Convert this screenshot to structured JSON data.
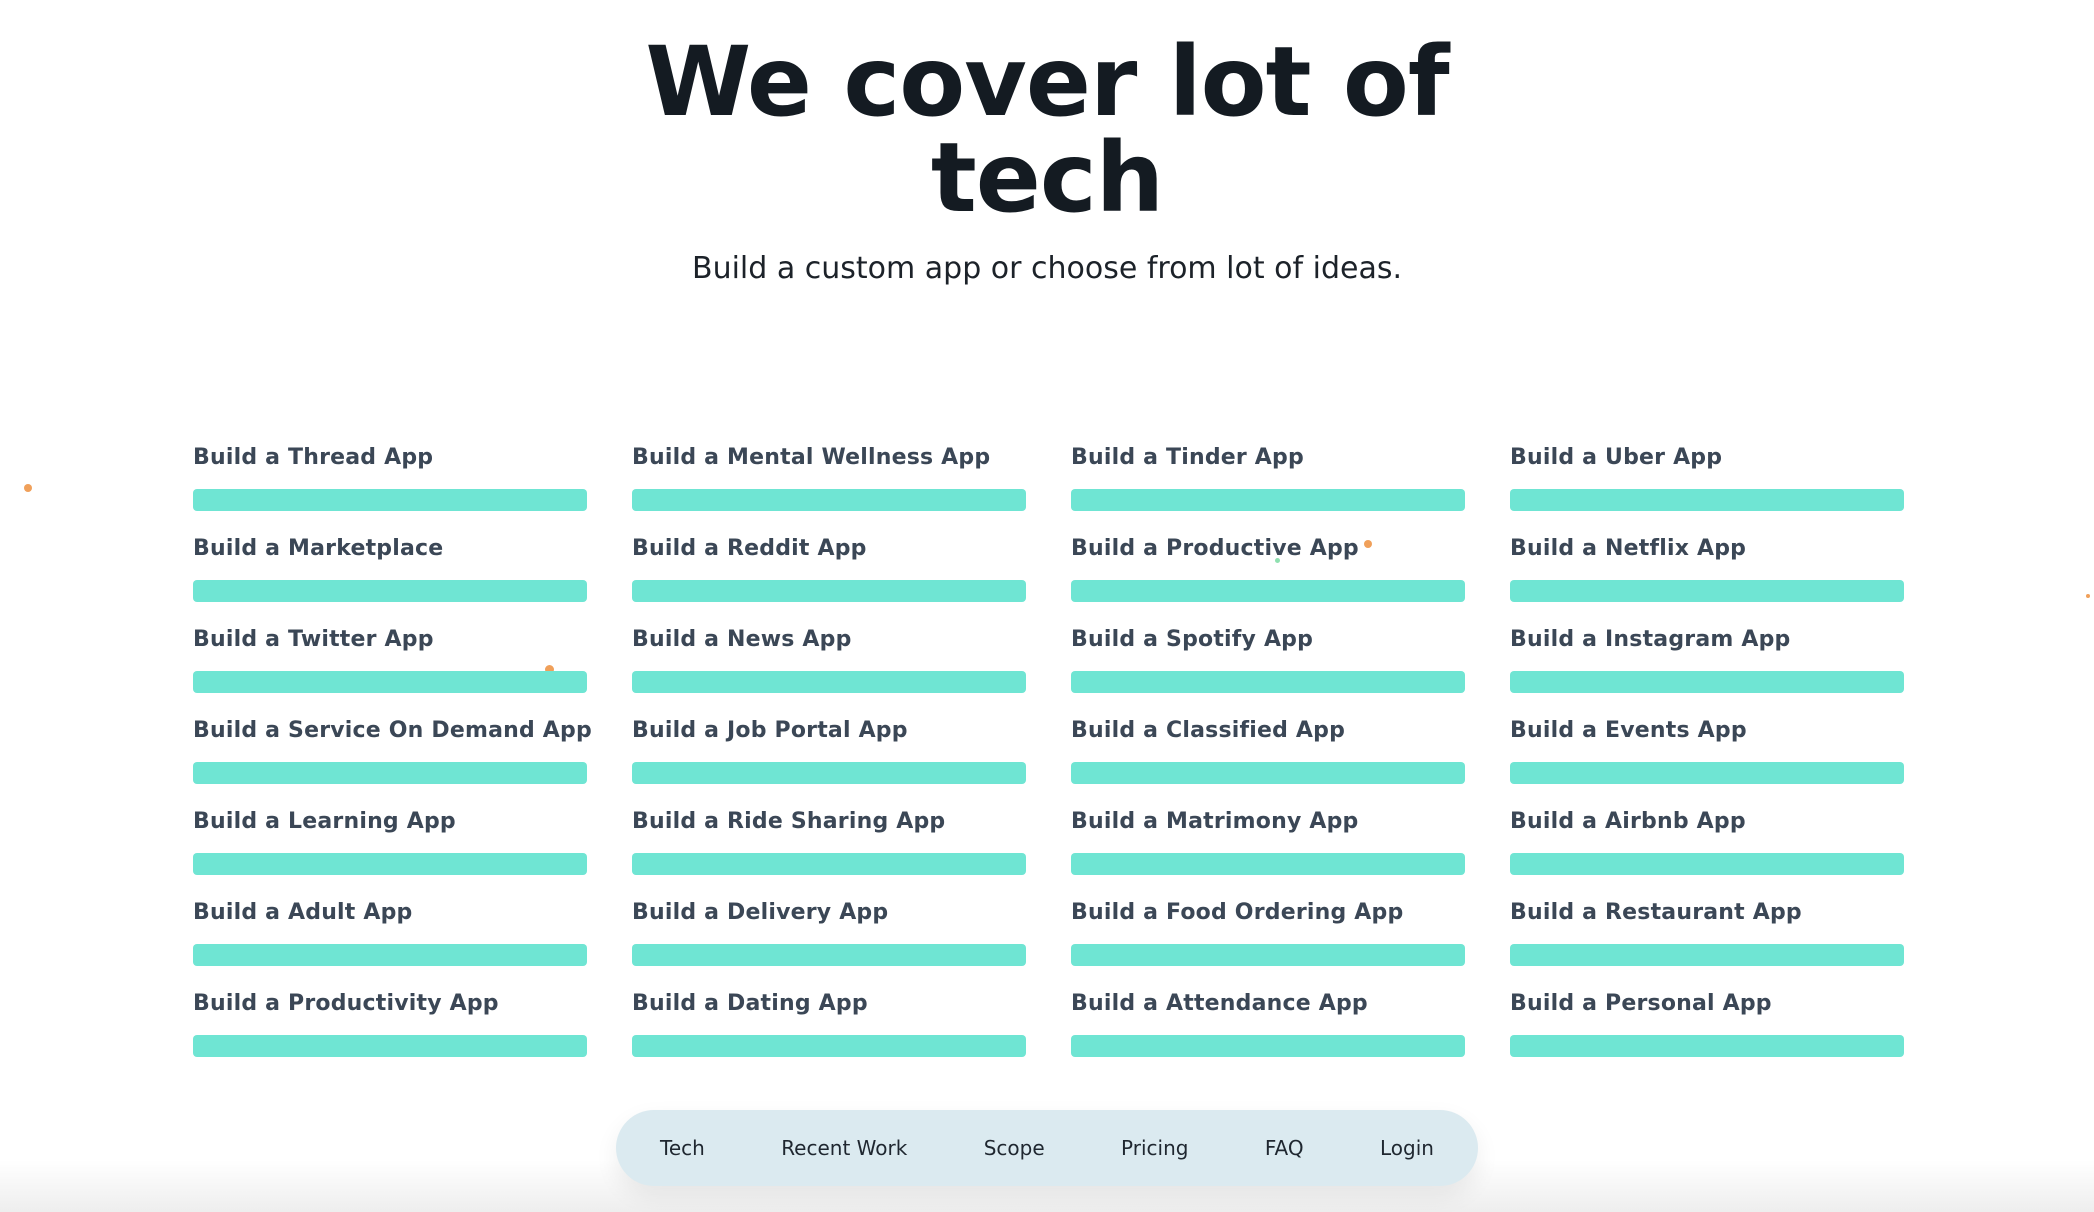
{
  "hero": {
    "title_line1": "We cover lot of",
    "title_line2": "tech",
    "subtitle": "Build a custom app or choose from lot of ideas."
  },
  "apps": [
    {
      "label": "Build a Thread App"
    },
    {
      "label": "Build a Mental Wellness App"
    },
    {
      "label": "Build a Tinder App"
    },
    {
      "label": "Build a Uber App"
    },
    {
      "label": "Build a Marketplace"
    },
    {
      "label": "Build a Reddit App"
    },
    {
      "label": "Build a Productive App"
    },
    {
      "label": "Build a Netflix App"
    },
    {
      "label": "Build a Twitter App"
    },
    {
      "label": "Build a News App"
    },
    {
      "label": "Build a Spotify App"
    },
    {
      "label": "Build a Instagram App"
    },
    {
      "label": "Build a Service On Demand App"
    },
    {
      "label": "Build a Job Portal App"
    },
    {
      "label": "Build a Classified App"
    },
    {
      "label": "Build a Events App"
    },
    {
      "label": "Build a Learning App"
    },
    {
      "label": "Build a Ride Sharing App"
    },
    {
      "label": "Build a Matrimony App"
    },
    {
      "label": "Build a Airbnb App"
    },
    {
      "label": "Build a Adult App"
    },
    {
      "label": "Build a Delivery App"
    },
    {
      "label": "Build a Food Ordering App"
    },
    {
      "label": "Build a Restaurant App"
    },
    {
      "label": "Build a Productivity App"
    },
    {
      "label": "Build a Dating App"
    },
    {
      "label": "Build a Attendance App"
    },
    {
      "label": "Build a Personal App"
    }
  ],
  "nav": {
    "items": [
      {
        "label": "Tech"
      },
      {
        "label": "Recent Work"
      },
      {
        "label": "Scope"
      },
      {
        "label": "Pricing"
      },
      {
        "label": "FAQ"
      },
      {
        "label": "Login"
      }
    ]
  },
  "colors": {
    "bar": "#6fe5d3",
    "nav_bg": "#dbeaf0",
    "dot_orange": "#f0a05a",
    "dot_green": "#8fe0b0"
  }
}
